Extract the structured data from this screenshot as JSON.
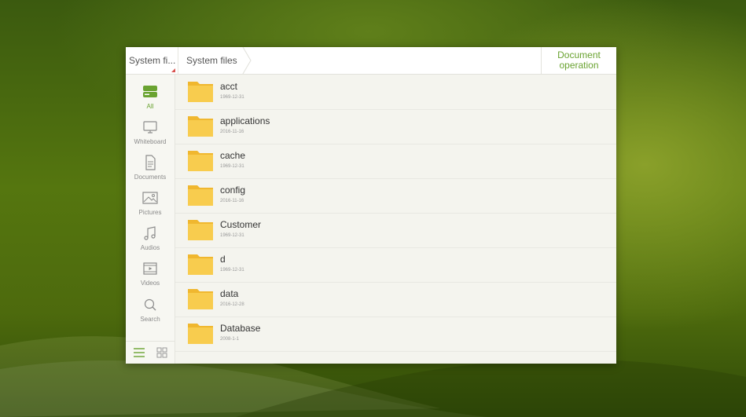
{
  "topbar": {
    "root_tab": "System fi...",
    "breadcrumb": "System files",
    "doc_operation": [
      "Document",
      "operation"
    ]
  },
  "sidebar": {
    "categories": [
      {
        "label": "All",
        "icon": "drive-icon",
        "active": true
      },
      {
        "label": "Whiteboard",
        "icon": "monitor-icon",
        "active": false
      },
      {
        "label": "Documents",
        "icon": "document-icon",
        "active": false
      },
      {
        "label": "Pictures",
        "icon": "image-icon",
        "active": false
      },
      {
        "label": "Audios",
        "icon": "music-note-icon",
        "active": false
      },
      {
        "label": "Videos",
        "icon": "film-icon",
        "active": false
      },
      {
        "label": "Search",
        "icon": "search-icon",
        "active": false
      }
    ],
    "view_toggle": {
      "selected": "list-view"
    }
  },
  "files": [
    {
      "name": "acct",
      "date": "1969-12-31"
    },
    {
      "name": "applications",
      "date": "2016-11-16"
    },
    {
      "name": "cache",
      "date": "1969-12-31"
    },
    {
      "name": "config",
      "date": "2016-11-16"
    },
    {
      "name": "Customer",
      "date": "1969-12-31"
    },
    {
      "name": "d",
      "date": "1969-12-31"
    },
    {
      "name": "data",
      "date": "2016-12-28"
    },
    {
      "name": "Database",
      "date": "2008-1-1"
    }
  ],
  "colors": {
    "accent": "#6aa331",
    "folder": "#f5c542"
  }
}
